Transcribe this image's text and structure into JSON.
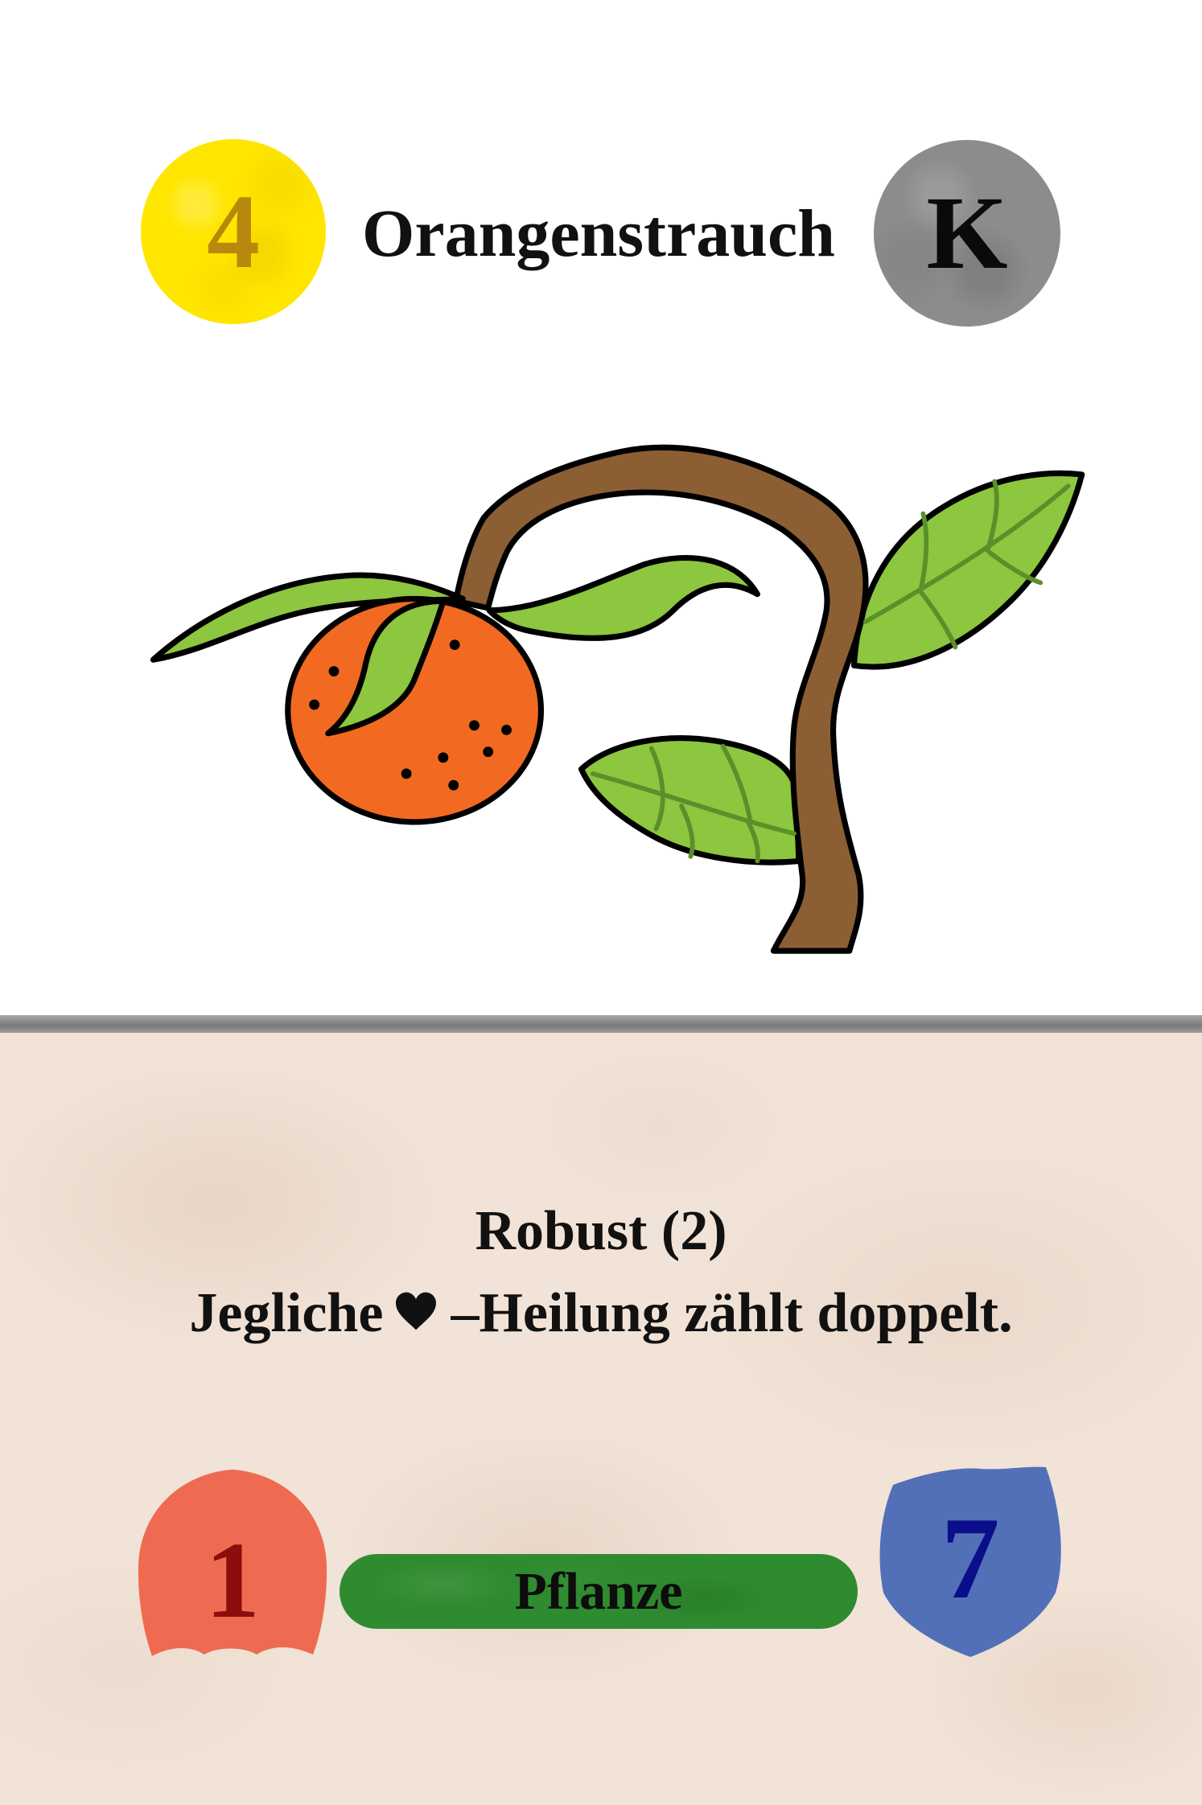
{
  "card": {
    "name": "Orangenstrauch",
    "cost": "4",
    "category": "K",
    "ability": {
      "title": "Robust (2)",
      "text_before_icon": "Jegliche",
      "icon": "heart-icon",
      "text_after_icon": "–Heilung zählt doppelt."
    },
    "attack": "1",
    "type": "Pflanze",
    "defense": "7"
  },
  "colors": {
    "cost_circle": "#ffe600",
    "cost_text": "#b8880e",
    "category_circle": "#8c8c8c",
    "category_text": "#0a0a0a",
    "attack_shield": "#ee6b52",
    "attack_text": "#8b0d0d",
    "defense_shield": "#5270b7",
    "defense_text": "#0b0e8a",
    "type_pill": "#2f8b30",
    "parchment": "#f1e3d7",
    "heart": "#111111"
  }
}
